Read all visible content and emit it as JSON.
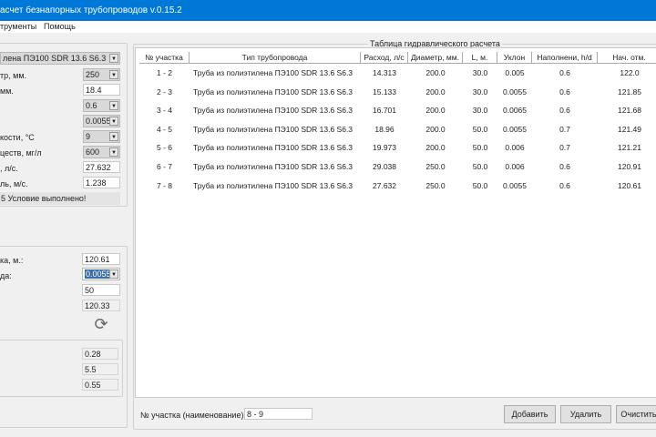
{
  "window": {
    "title": "асчет безнапорных трубопроводов  v.0.15.2"
  },
  "menu": [
    "трументы",
    "Помощь"
  ],
  "params": {
    "pipe_type": "лена ПЭ100 SDR 13.6 S6.3",
    "diameter_label": "тр, мм.",
    "diameter": "250",
    "inner_label": "мм.",
    "inner": "18.4",
    "fill": "0.6",
    "slope": "0.0055",
    "temp_label": "кости, °C",
    "temp": "9",
    "subst_label": "цеств, мг/л",
    "subst": "600",
    "flow_label": ", л/с.",
    "flow": "27.632",
    "speed_label": "ль, м/с.",
    "speed": "1.238",
    "status": "5  Условие выполнено!"
  },
  "marks": {
    "start_label": "ка, м.:",
    "start": "120.61",
    "slope_label": "да:",
    "slope": "0.0055",
    "length": "50",
    "end": "120.33",
    "r1": "0.28",
    "r2": "5.5",
    "r3": "0.55"
  },
  "table": {
    "title": "Таблица гидравлического расчета",
    "headers": [
      "№ участка",
      "Тип трубопровода",
      "Расход, л/с",
      "Диаметр, мм.",
      "L, м.",
      "Уклон",
      "Наполнени, h/d",
      "Нач. отм."
    ],
    "rows": [
      [
        "1 - 2",
        "Труба из полиэтилена ПЭ100 SDR 13.6 S6.3",
        "14.313",
        "200.0",
        "30.0",
        "0.005",
        "0.6",
        "122.0"
      ],
      [
        "2 - 3",
        "Труба из полиэтилена ПЭ100 SDR 13.6 S6.3",
        "15.133",
        "200.0",
        "30.0",
        "0.0055",
        "0.6",
        "121.85"
      ],
      [
        "3 - 4",
        "Труба из полиэтилена ПЭ100 SDR 13.6 S6.3",
        "16.701",
        "200.0",
        "30.0",
        "0.0065",
        "0.6",
        "121.68"
      ],
      [
        "4 - 5",
        "Труба из полиэтилена ПЭ100 SDR 13.6 S6.3",
        "18.96",
        "200.0",
        "50.0",
        "0.0055",
        "0.7",
        "121.49"
      ],
      [
        "5 - 6",
        "Труба из полиэтилена ПЭ100 SDR 13.6 S6.3",
        "19.973",
        "200.0",
        "50.0",
        "0.006",
        "0.7",
        "121.21"
      ],
      [
        "6 - 7",
        "Труба из полиэтилена ПЭ100 SDR 13.6 S6.3",
        "29.038",
        "250.0",
        "50.0",
        "0.006",
        "0.6",
        "120.91"
      ],
      [
        "7 - 8",
        "Труба из полиэтилена ПЭ100 SDR 13.6 S6.3",
        "27.632",
        "250.0",
        "50.0",
        "0.0055",
        "0.6",
        "120.61"
      ]
    ]
  },
  "bottom": {
    "section_label": "№ участка (наименование)",
    "section_value": "8 - 9",
    "add": "Добавить",
    "delete": "Удалить",
    "clear": "Очистить"
  }
}
